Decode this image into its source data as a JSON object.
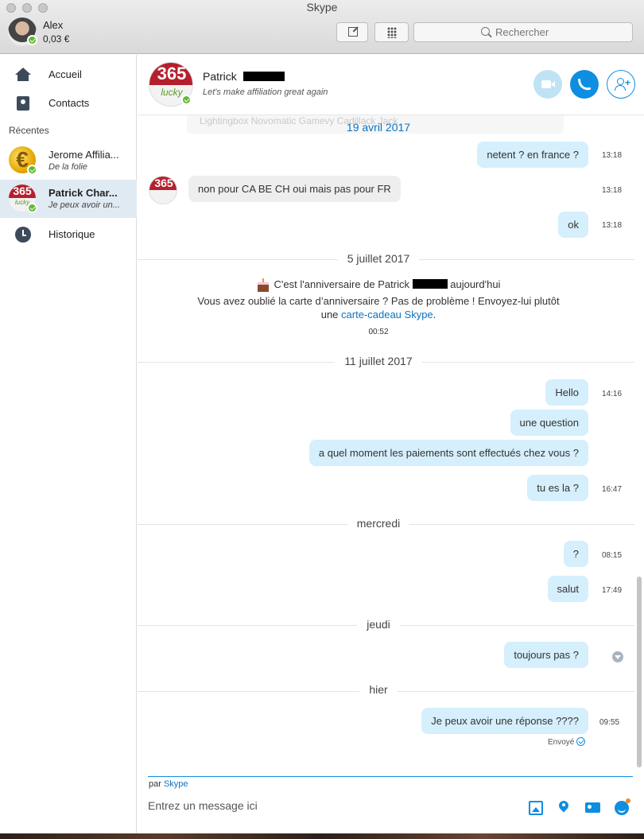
{
  "window": {
    "title": "Skype"
  },
  "user": {
    "name": "Alex",
    "credit": "0,03 €"
  },
  "search": {
    "placeholder": "Rechercher"
  },
  "sidebar": {
    "nav": [
      {
        "label": "Accueil",
        "icon": "home-icon"
      },
      {
        "label": "Contacts",
        "icon": "contacts-icon"
      }
    ],
    "recents_label": "Récentes",
    "recents": [
      {
        "name": "Jerome Affilia...",
        "sub": "De la folie"
      },
      {
        "name": "Patrick Char...",
        "sub": "Je peux avoir un..."
      }
    ],
    "history_label": "Historique"
  },
  "header": {
    "name": "Patrick",
    "mood": "Let's make affiliation great again",
    "logo_number": "365",
    "logo_sub": "lucky"
  },
  "chat": {
    "ghost_text": "Lightingbox  Novomatic   Gamevy  Cadillack Jack",
    "dates": {
      "d1": "19 avril 2017",
      "d2": "5 juillet 2017",
      "d3": "11 juillet 2017",
      "d4": "mercredi",
      "d5": "jeudi",
      "d6": "hier"
    },
    "messages": [
      {
        "text": "netent ? en france ?",
        "time": "13:18",
        "dir": "out"
      },
      {
        "text": "non pour CA BE CH oui mais pas pour FR",
        "time": "13:18",
        "dir": "in"
      },
      {
        "text": "ok",
        "time": "13:18",
        "dir": "out"
      },
      {
        "text": "Hello",
        "time": "14:16",
        "dir": "out"
      },
      {
        "text": "une question",
        "time": "",
        "dir": "out"
      },
      {
        "text": "a quel moment les paiements sont effectués chez vous ?",
        "time": "",
        "dir": "out"
      },
      {
        "text": "tu es la ?",
        "time": "16:47",
        "dir": "out"
      },
      {
        "text": "?",
        "time": "08:15",
        "dir": "out"
      },
      {
        "text": "salut",
        "time": "17:49",
        "dir": "out"
      },
      {
        "text": "toujours pas ?",
        "time": "",
        "dir": "out"
      },
      {
        "text": "Je peux avoir une réponse ????",
        "time": "09:55",
        "dir": "out"
      }
    ],
    "birthday": {
      "line1_a": "C'est l'anniversaire de ",
      "line1_name": "Patrick",
      "line1_b": "aujourd'hui",
      "line2": "Vous avez oublié la carte d’anniversaire ? Pas de problème ! Envoyez-lui plutôt",
      "line3_a": "une ",
      "line3_link": "carte-cadeau Skype",
      "line3_b": ".",
      "time": "00:52"
    },
    "sent_status": "Envoyé"
  },
  "composer": {
    "via_prefix": "par ",
    "via_link": "Skype",
    "placeholder": "Entrez un message ici"
  },
  "colors": {
    "accent": "#0d8ee1",
    "bubble_out": "#d5effc",
    "bubble_in": "#eeeeee",
    "presence": "#5fb830",
    "sidebar_active": "#dfeaf3"
  }
}
